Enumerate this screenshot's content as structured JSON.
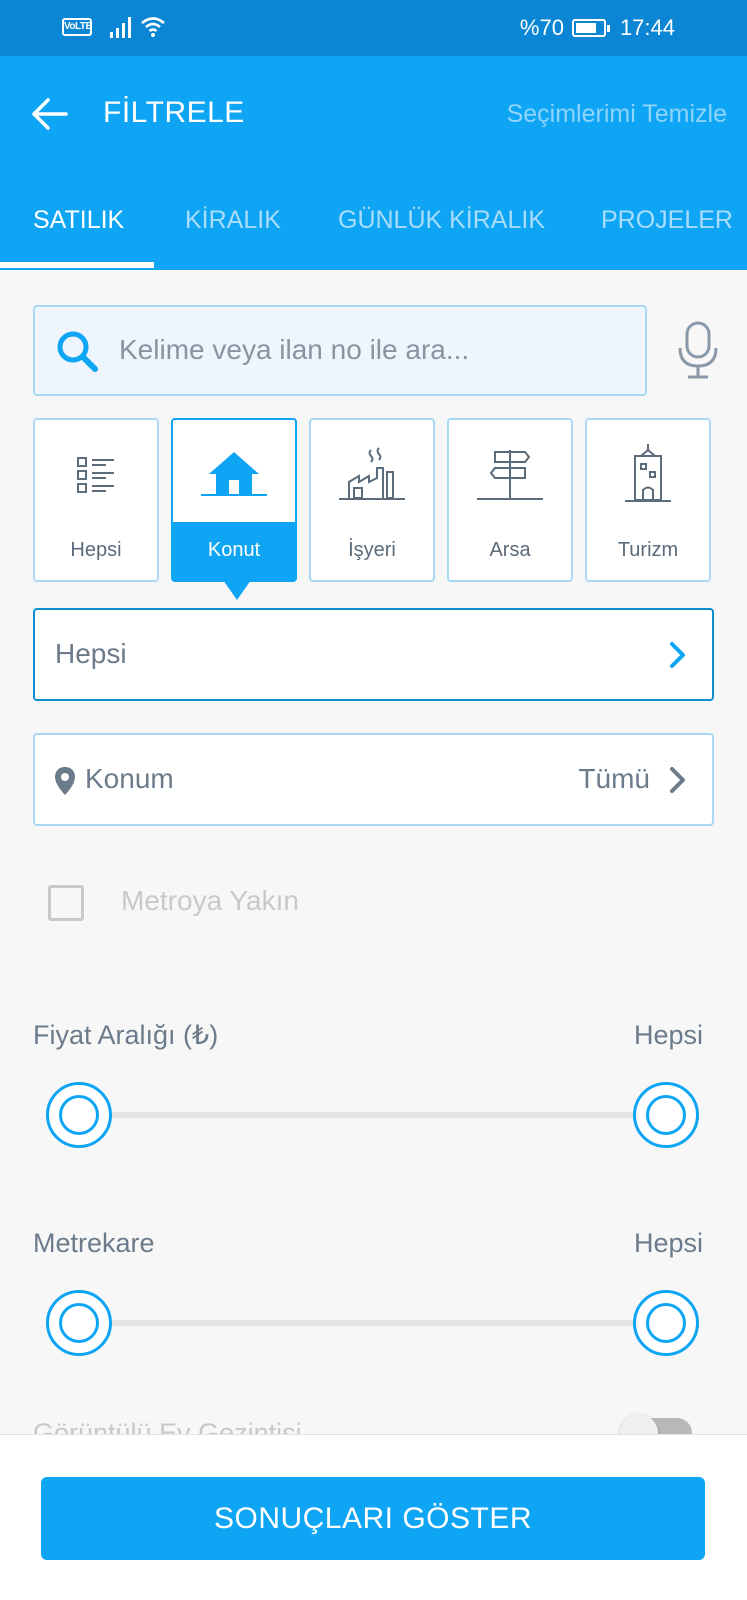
{
  "status_bar": {
    "volte": "VoLTE",
    "battery": "%70",
    "time": "17:44"
  },
  "header": {
    "title": "FİLTRELE",
    "clear_label": "Seçimlerimi Temizle"
  },
  "tabs": [
    {
      "label": "SATILIK",
      "active": true
    },
    {
      "label": "KİRALIK",
      "active": false
    },
    {
      "label": "GÜNLÜK KİRALIK",
      "active": false
    },
    {
      "label": "PROJELER",
      "active": false
    }
  ],
  "search": {
    "placeholder": "Kelime veya ilan no ile ara..."
  },
  "categories": [
    {
      "label": "Hepsi",
      "icon": "list-icon",
      "active": false
    },
    {
      "label": "Konut",
      "icon": "house-icon",
      "active": true
    },
    {
      "label": "İşyeri",
      "icon": "factory-icon",
      "active": false
    },
    {
      "label": "Arsa",
      "icon": "signpost-icon",
      "active": false
    },
    {
      "label": "Turizm",
      "icon": "building-icon",
      "active": false
    }
  ],
  "subcategory": {
    "value": "Hepsi"
  },
  "location": {
    "label": "Konum",
    "value": "Tümü"
  },
  "metro": {
    "label": "Metroya Yakın",
    "checked": false
  },
  "price_range": {
    "title": "Fiyat Aralığı (₺)",
    "value": "Hepsi"
  },
  "area_range": {
    "title": "Metrekare",
    "value": "Hepsi"
  },
  "video_tour": {
    "label": "Görüntülü Ev Gezintisi",
    "enabled": false
  },
  "footer": {
    "show_results_label": "SONUÇLARI GÖSTER"
  },
  "colors": {
    "primary": "#0ea5f5",
    "status_bar": "#0a86d4",
    "border_light": "#a8d8f4"
  }
}
